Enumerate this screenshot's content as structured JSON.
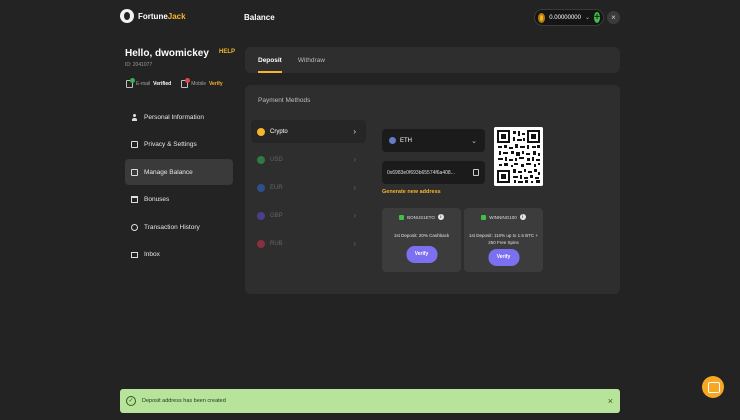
{
  "header": {
    "logo_main": "Fortune",
    "logo_accent": "Jack",
    "page_title": "Balance",
    "balance_value": "0.00000000",
    "plus_symbol": "+",
    "close_symbol": "×"
  },
  "profile": {
    "greeting": "Hello, dwomickey",
    "help": "HELP",
    "user_id": "ID: 2041077",
    "email_label": "E-mail",
    "email_status": "Verified",
    "mobile_label": "Mobile",
    "mobile_status": "Verify"
  },
  "menu": {
    "items": [
      {
        "label": "Personal Information",
        "icon": "user-icon"
      },
      {
        "label": "Privacy & Settings",
        "icon": "settings-icon"
      },
      {
        "label": "Manage Balance",
        "icon": "wallet-icon",
        "active": true
      },
      {
        "label": "Bonuses",
        "icon": "gift-icon"
      },
      {
        "label": "Transaction History",
        "icon": "history-icon"
      },
      {
        "label": "Inbox",
        "icon": "mail-icon"
      }
    ]
  },
  "tabs": {
    "deposit": "Deposit",
    "withdraw": "Withdraw"
  },
  "payment": {
    "title": "Payment Methods",
    "methods": [
      {
        "label": "Crypto",
        "color": "#f7b529"
      },
      {
        "label": "USD",
        "color": "#2f7a3f"
      },
      {
        "label": "EUR",
        "color": "#2f4f8a"
      },
      {
        "label": "GBP",
        "color": "#4a3f8a"
      },
      {
        "label": "RUB",
        "color": "#8a2f3f"
      }
    ],
    "currency_selected": "ETH",
    "address": "0x6983e0f693b65574f6a408...",
    "generate_link": "Generate new address"
  },
  "bonuses": [
    {
      "code": "BONUS1ETO",
      "description": "1st Deposit: 20% Cashback",
      "button": "Verify"
    },
    {
      "code": "WINNING100",
      "description": "1st Deposit: 110% up to 1.5 BTC + 250 Free Spins",
      "button": "Verify"
    }
  ],
  "toast": {
    "message": "Deposit address has been created",
    "close_symbol": "×"
  },
  "colors": {
    "accent": "#f7b529",
    "verify_button": "#7c6ff0",
    "toast_bg": "#b7e39a"
  }
}
